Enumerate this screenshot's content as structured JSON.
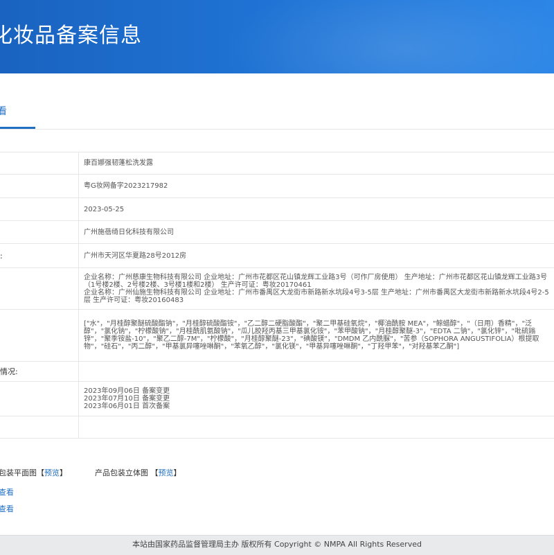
{
  "banner": {
    "title": "化妆品备案信息"
  },
  "tabs": [
    {
      "label": "看"
    }
  ],
  "rows": {
    "product_name": {
      "label": "",
      "value": "康百娜强韧蓬松洗发露"
    },
    "record_number": {
      "label": "",
      "value": "粤G妆网备字2023217982"
    },
    "record_date": {
      "label": "",
      "value": "2023-05-25"
    },
    "registrant": {
      "label": "",
      "value": "广州施蓓绮日化科技有限公司"
    },
    "address": {
      "label": ":",
      "value": "广州市天河区华夏路28号2012房"
    },
    "manufacturers": [
      "企业名称：广州慈康生物科技有限公司 企业地址：广州市花都区花山镇龙辉工业路3号（可作厂房使用） 生产地址：广州市花都区花山镇龙辉工业路3号（1号楼2楼、2号楼2楼、3号楼1楼和2楼） 生产许可证：粤妆20170461",
      "企业名称：广州仙施生物科技有限公司 企业地址：广州市番禺区大龙街市新路新水坑段4号3-5层 生产地址：广州市番禺区大龙街市新路新水坑段4号2-5层 生产许可证：粤妆20160483"
    ],
    "ingredients": {
      "value": "[\"水\"，\"月桂醇聚醚硫酸酯钠\"，\"月桂醇硫酸酯铵\"，\"乙二醇二硬脂酸酯\"，\"聚二甲基硅氧烷\"，\"椰油酰胺 MEA\"，\"鲸蜡醇\"，\"（日用）香精\"，\"泛醇\"，\"氯化钠\"，\"柠檬酸钠\"，\"月桂酰肌氨酸钠\"，\"瓜儿胶羟丙基三甲基氯化铵\"，\"苯甲酸钠\"，\"月桂醇聚醚-3\"，\"EDTA 二钠\"，\"氯化锌\"，\"吡硫鎓锌\"，\"聚季铵盐-10\"，\"聚乙二醇-7M\"，\"柠檬酸\"，\"月桂醇聚醚-23\"，\"碘酸镁\"，\"DMDM 乙内酰脲\"，\"苦参（SOPHORA ANGUSTIFOLIA）根提取物\"，\"硅石\"，\"丙二醇\"，\"甲基氯异噻唑啉酮\"，\"苯氧乙醇\"，\"氯化镁\"，\"甲基异噻唑啉酮\"，\"丁羟甲苯\"，\"对羟基苯乙酮\"]"
    },
    "status": {
      "label": "情况:",
      "value": ""
    },
    "history": [
      "2023年09月06日 备案变更",
      "2023年07月10日 备案变更",
      "2023年06月01日 首次备案"
    ],
    "empty": {
      "label": "",
      "value": ""
    }
  },
  "packaging": {
    "flat_label": "包装平面图",
    "flat_link": "预览",
    "solid_label": "产品包装立体图",
    "solid_link": "预览",
    "bracket_open": "【",
    "bracket_close": "】"
  },
  "links": [
    "查看",
    "查看"
  ],
  "footer": {
    "text": "本站由国家药品监督管理局主办 版权所有 Copyright © NMPA All Rights Reserved"
  }
}
